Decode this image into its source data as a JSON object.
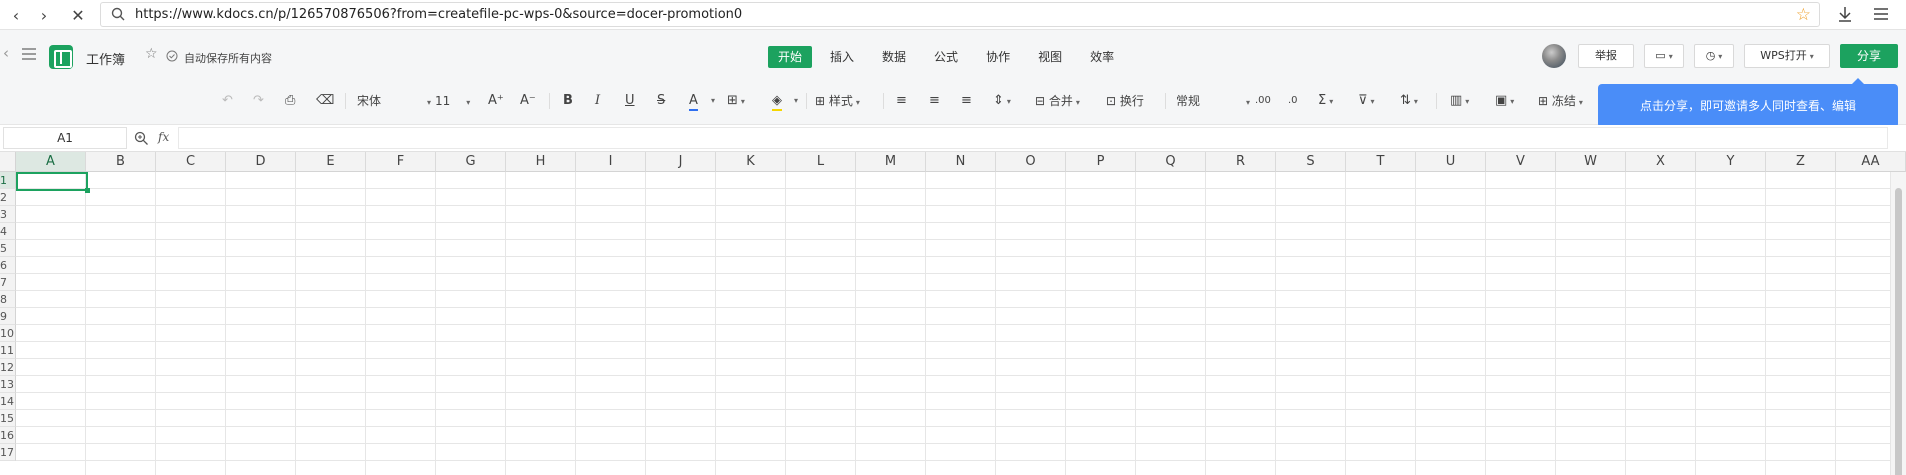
{
  "browser": {
    "url": "https://www.kdocs.cn/p/126570876506?from=createfile-pc-wps-0&source=docer-promotion0"
  },
  "header": {
    "title": "工作簿",
    "autosave": "自动保存所有内容",
    "tabs": [
      "开始",
      "插入",
      "数据",
      "公式",
      "协作",
      "视图",
      "效率"
    ],
    "active_tab": "开始",
    "report_label": "举报",
    "wps_open_label": "WPS打开",
    "share_label": "分享"
  },
  "toolbar": {
    "font_name": "宋体",
    "font_size": "11",
    "style_label": "样式",
    "merge_label": "合并",
    "wrap_label": "换行",
    "number_format": "常规",
    "freeze_label": "冻结"
  },
  "tooltip": {
    "text": "点击分享，即可邀请多人同时查看、编辑"
  },
  "formula_bar": {
    "cell_ref": "A1",
    "fx_label": "fx",
    "content": ""
  },
  "grid": {
    "columns": [
      "A",
      "B",
      "C",
      "D",
      "E",
      "F",
      "G",
      "H",
      "I",
      "J",
      "K",
      "L",
      "M",
      "N",
      "O",
      "P",
      "Q",
      "R",
      "S",
      "T",
      "U",
      "V",
      "W",
      "X",
      "Y",
      "Z",
      "AA"
    ],
    "rows": [
      "1",
      "2",
      "3",
      "4",
      "5",
      "6",
      "7",
      "8",
      "9",
      "10",
      "11",
      "12",
      "13",
      "14",
      "15",
      "16",
      "17"
    ],
    "selected_cell": "A1"
  },
  "colors": {
    "accent": "#1ca25f",
    "tooltip": "#4a8df8"
  }
}
